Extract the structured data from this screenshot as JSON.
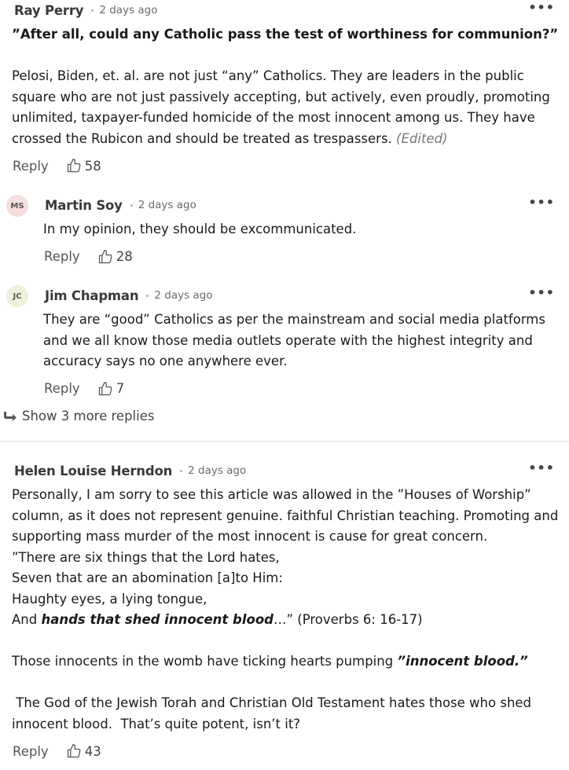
{
  "comments": [
    {
      "author": "Ray Perry",
      "time": "2 days ago",
      "quote": "”After all, could any Catholic pass the test of worthiness for communion?”",
      "text": "Pelosi, Biden, et. al.  are not just “any” Catholics.    They are leaders in the public square who are not just passively accepting, but actively, even proudly,  promoting unlimited, taxpayer-funded  homicide of the most innocent among us.   They have crossed the Rubicon and should be treated as trespassers.",
      "edited": "(Edited)",
      "reply_label": "Reply",
      "likes": "58"
    },
    {
      "author": "Martin Soy",
      "initials": "MS",
      "time": "2 days ago",
      "text": "In my opinion, they should be excommunicated.",
      "reply_label": "Reply",
      "likes": "28"
    },
    {
      "author": "Jim Chapman",
      "initials": "JC",
      "time": "2 days ago",
      "text": "They are “good” Catholics as per the mainstream and social media platforms and we all know those media outlets operate with the highest integrity and accuracy says no one anywhere ever.",
      "reply_label": "Reply",
      "likes": "7"
    },
    {
      "author": "Helen Louise Herndon",
      "time": "2 days ago",
      "line1": "Personally, I am sorry to see this article was allowed in the ”Houses of Worship” column, as it does not represent genuine. faithful Christian teaching.  Promoting and supporting mass murder of the most innocent is cause for great concern.",
      "line2": "”There are six things that the Lord hates,",
      "line3": "Seven that are an abomination [a]to Him:",
      "line4": "Haughty eyes, a lying tongue,",
      "line5_pre": "And ",
      "line5_bold": "hands that shed innocent blood",
      "line5_post": "…” (Proverbs 6: 16-17)",
      "line6_pre": "Those innocents in the womb have ticking hearts pumping ",
      "line6_bold": "”innocent blood.”",
      "line7": " The God of the Jewish Torah and Christian Old Testament hates those who shed innocent blood.  That’s quite potent, isn’t it?",
      "reply_label": "Reply",
      "likes": "43"
    }
  ],
  "show_more_replies": "Show 3 more replies",
  "more_menu_glyph": "•••",
  "icons": {
    "like": "thumbs-up-icon",
    "reply_arrow": "reply-arrow-icon",
    "more": "more-options-icon"
  },
  "colors": {
    "avatar_ms": "#f6dede",
    "avatar_jc": "#eef0d9",
    "divider": "#e2e2e2"
  }
}
